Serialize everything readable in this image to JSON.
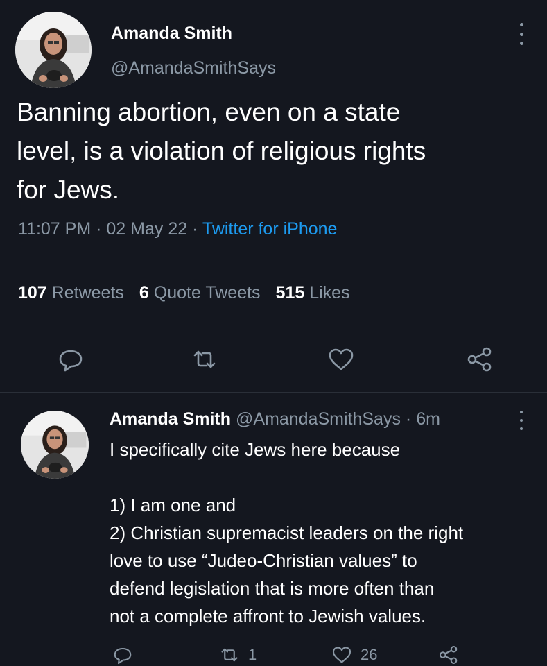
{
  "tweet": {
    "display_name": "Amanda Smith",
    "handle": "@AmandaSmithSays",
    "text_lines": [
      "Banning abortion, even on a state",
      "level, is a violation of religious rights",
      "for Jews."
    ],
    "time": "11:07 PM",
    "date": "02 May 22",
    "source": "Twitter for iPhone",
    "retweets_count": "107",
    "retweets_label": "Retweets",
    "quotes_count": "6",
    "quotes_label": "Quote Tweets",
    "likes_count": "515",
    "likes_label": "Likes",
    "actions": [
      "reply-icon",
      "retweet-icon",
      "like-icon",
      "share-icon"
    ]
  },
  "reply": {
    "display_name": "Amanda Smith",
    "handle": "@AmandaSmithSays",
    "age": "6m",
    "lines": [
      "I specifically cite Jews here because",
      "",
      "1) I am one and",
      "2) Christian supremacist leaders on the right",
      "love to use “Judeo-Christian values” to",
      "defend legislation that is more often than",
      "not a complete affront to Jewish values."
    ],
    "retweet_count": "1",
    "like_count": "26"
  },
  "colors": {
    "background": "#14171f",
    "secondary_text": "#8b98a5",
    "link": "#1d9bf0"
  }
}
